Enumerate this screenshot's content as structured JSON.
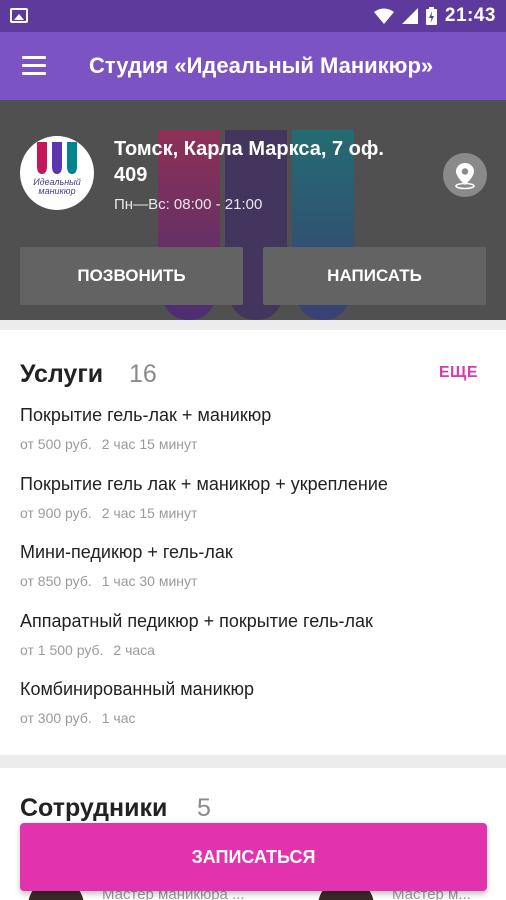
{
  "status_bar": {
    "time": "21:43"
  },
  "app_bar": {
    "title": "Студия «Идеальный Маникюр»"
  },
  "header": {
    "logo_text_line1": "Идеальный",
    "logo_text_line2": "маникюр",
    "address": "Томск, Карла Маркса, 7 оф. 409",
    "hours": "Пн—Вс: 08:00 - 21:00",
    "call_label": "ПОЗВОНИТЬ",
    "write_label": "НАПИСАТЬ"
  },
  "services": {
    "title": "Услуги",
    "count": "16",
    "more_label": "ЕЩЕ",
    "items": [
      {
        "name": "Покрытие гель-лак + маникюр",
        "price": "от 500 руб.",
        "duration": "2 час 15 минут"
      },
      {
        "name": "Покрытие гель лак + маникюр + укрепление",
        "price": "от 900 руб.",
        "duration": "2 час 15 минут"
      },
      {
        "name": "Мини-педикюр + гель-лак",
        "price": "от 850 руб.",
        "duration": "1 час 30 минут"
      },
      {
        "name": "Аппаратный педикюр + покрытие гель-лак",
        "price": "от 1 500 руб.",
        "duration": "2 часа"
      },
      {
        "name": "Комбинированный маникюр",
        "price": "от 300 руб.",
        "duration": "1 час"
      }
    ]
  },
  "staff": {
    "title": "Сотрудники",
    "count": "5",
    "members": [
      {
        "name": "Мастер маникюра ..."
      },
      {
        "name": "Мастер м..."
      }
    ]
  },
  "book_label": "ЗАПИСАТЬСЯ",
  "colors": {
    "status_bar": "#5e3a9c",
    "app_bar": "#7c53c3",
    "accent": "#e332ad",
    "more_link": "#d63cae"
  }
}
